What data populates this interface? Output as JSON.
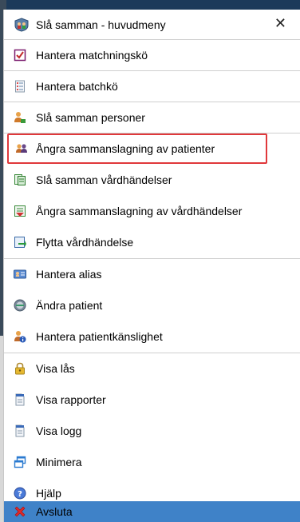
{
  "header": {
    "title": "Slå samman - huvudmeny",
    "icon": "app-icon",
    "close_glyph": "✕"
  },
  "items": [
    {
      "label": "Hantera matchningskö",
      "icon": "checklist-icon"
    },
    {
      "label": "Hantera batchkö",
      "icon": "list-icon"
    },
    {
      "label": "Slå samman personer",
      "icon": "merge-persons-icon"
    },
    {
      "label": "Ångra sammanslagning av patienter",
      "icon": "undo-merge-patients-icon",
      "highlighted": true
    },
    {
      "label": "Slå samman vårdhändelser",
      "icon": "merge-events-icon"
    },
    {
      "label": "Ångra sammanslagning av vårdhändelser",
      "icon": "undo-merge-events-icon"
    },
    {
      "label": "Flytta vårdhändelse",
      "icon": "move-event-icon"
    },
    {
      "label": "Hantera alias",
      "icon": "alias-card-icon"
    },
    {
      "label": "Ändra patient",
      "icon": "edit-patient-icon"
    },
    {
      "label": "Hantera patientkänslighet",
      "icon": "sensitivity-icon"
    },
    {
      "label": "Visa lås",
      "icon": "lock-icon"
    },
    {
      "label": "Visa rapporter",
      "icon": "document-icon"
    },
    {
      "label": "Visa logg",
      "icon": "document-icon"
    },
    {
      "label": "Minimera",
      "icon": "minimize-window-icon"
    },
    {
      "label": "Hjälp",
      "icon": "help-icon"
    },
    {
      "label": "Avsluta",
      "icon": "exit-x-icon",
      "active": true
    }
  ],
  "colors": {
    "highlight_border": "#e0383b",
    "active_bg": "#3f82c8",
    "separator": "#cfcfcf"
  }
}
